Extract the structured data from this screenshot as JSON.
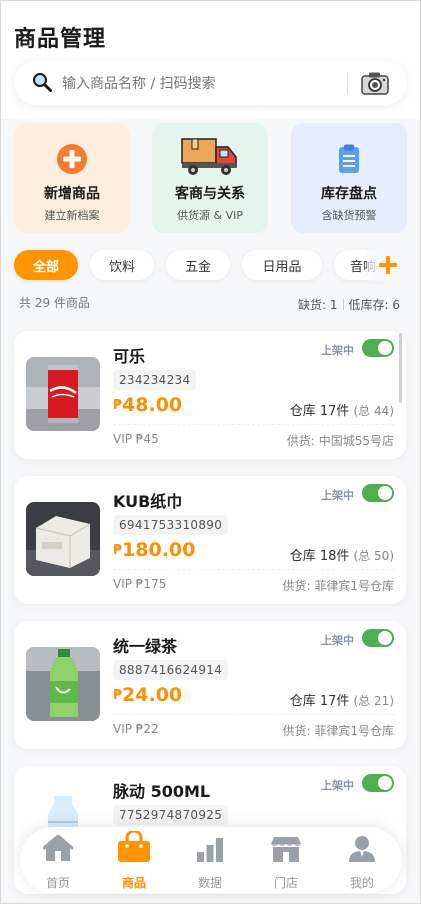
{
  "header": {
    "title": "商品管理",
    "search_placeholder": "输入商品名称 / 扫码搜索"
  },
  "quick_actions": [
    {
      "title": "新增商品",
      "subtitle": "建立新档案",
      "icon": "plus-circle-icon",
      "color": "#f97b2f"
    },
    {
      "title": "客商与关系",
      "subtitle": "供货源 & VIP",
      "icon": "delivery-truck-icon",
      "color": "#e0473c"
    },
    {
      "title": "库存盘点",
      "subtitle": "含缺货预警",
      "icon": "clipboard-icon",
      "color": "#4a90e2"
    }
  ],
  "categories": {
    "items": [
      "全部",
      "饮料",
      "五金",
      "日用品",
      "音响"
    ],
    "active": "全部"
  },
  "summary": {
    "count_text": "共 29 件商品",
    "out_of_stock": "缺货: 1",
    "low_stock": "低库存: 6"
  },
  "products": [
    {
      "name": "可乐",
      "code": "234234234",
      "status": "上架中",
      "enabled": true,
      "currency": "₱",
      "price": "48.00",
      "stock": "仓库 17件",
      "total": "(总 44)",
      "vip": "VIP ₱45",
      "supplier": "供货: 中国城55号店"
    },
    {
      "name": "KUB纸巾",
      "code": "6941753310890",
      "status": "上架中",
      "enabled": true,
      "currency": "₱",
      "price": "180.00",
      "stock": "仓库 18件",
      "total": "(总 50)",
      "vip": "VIP ₱175",
      "supplier": "供货: 菲律宾1号仓库"
    },
    {
      "name": "统一绿茶",
      "code": "8887416624914",
      "status": "上架中",
      "enabled": true,
      "currency": "₱",
      "price": "24.00",
      "stock": "仓库 17件",
      "total": "(总 21)",
      "vip": "VIP ₱22",
      "supplier": "供货: 菲律宾1号仓库"
    },
    {
      "name": "脉动 500ML",
      "code": "7752974870925",
      "status": "上架中",
      "enabled": true
    }
  ],
  "tabbar": {
    "items": [
      {
        "label": "首页",
        "icon": "home-icon"
      },
      {
        "label": "商品",
        "icon": "shopping-bag-icon"
      },
      {
        "label": "数据",
        "icon": "bar-chart-icon"
      },
      {
        "label": "门店",
        "icon": "store-icon"
      },
      {
        "label": "我的",
        "icon": "user-icon"
      }
    ],
    "active": "商品"
  },
  "colors": {
    "accent": "#ff9500",
    "price": "#ff8f00",
    "toggle_on": "#4caf50"
  }
}
